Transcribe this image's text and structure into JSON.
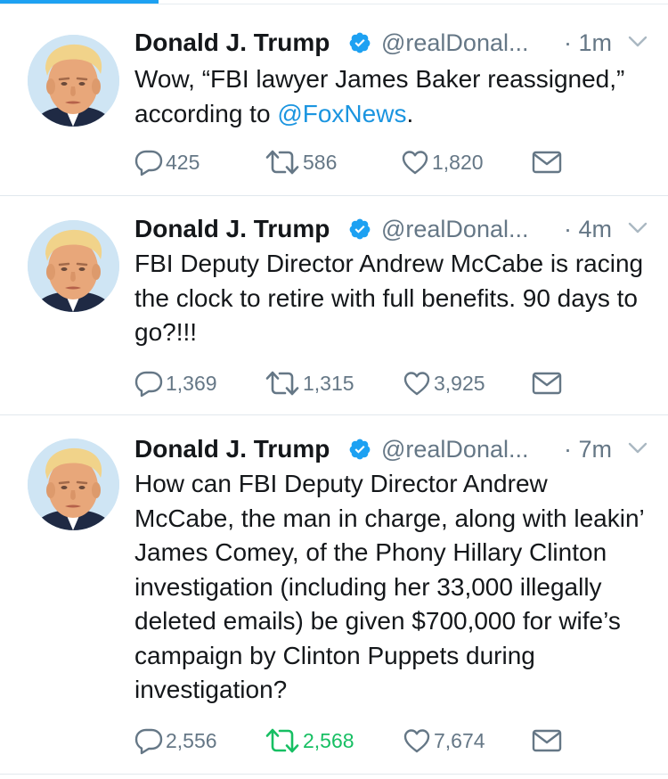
{
  "colors": {
    "accent": "#1da1f2",
    "link": "#1b95e0",
    "muted": "#657786",
    "retweeted": "#17bf63"
  },
  "icons": {
    "verified": "verified-badge-icon",
    "caret": "chevron-down-icon",
    "reply": "reply-icon",
    "retweet": "retweet-icon",
    "like": "heart-icon",
    "dm": "envelope-icon"
  },
  "tweets": [
    {
      "name": "Donald J. Trump",
      "handle": "@realDonal...",
      "time": "· 1m",
      "text_before": "Wow, “FBI lawyer James Baker reassigned,” according to ",
      "mention": "@FoxNews",
      "text_after": ".",
      "replies": "425",
      "retweets": "586",
      "likes": "1,820",
      "retweeted": false
    },
    {
      "name": "Donald J. Trump",
      "handle": "@realDonal...",
      "time": "· 4m",
      "text": "FBI Deputy Director Andrew McCabe is racing the clock to retire with full benefits. 90 days to go?!!!",
      "replies": "1,369",
      "retweets": "1,315",
      "likes": "3,925",
      "retweeted": false
    },
    {
      "name": "Donald J. Trump",
      "handle": "@realDonal...",
      "time": "· 7m",
      "text": "How can FBI Deputy Director Andrew McCabe, the man in charge, along with leakin’ James Comey, of the Phony Hillary Clinton investigation (including her 33,000 illegally deleted emails) be given $700,000 for wife’s campaign by Clinton Puppets during investigation?",
      "replies": "2,556",
      "retweets": "2,568",
      "likes": "7,674",
      "retweeted": true
    }
  ]
}
